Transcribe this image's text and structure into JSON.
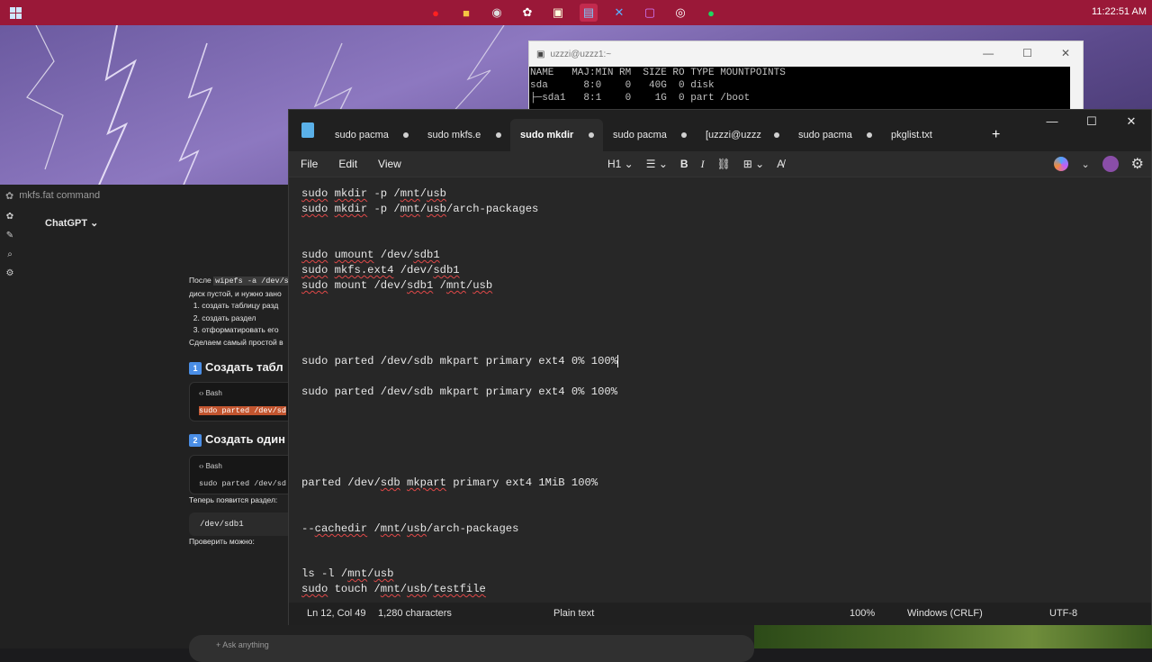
{
  "taskbar": {
    "clock": "11:22:51 AM",
    "icons": [
      "opera-icon",
      "files-icon",
      "obs-icon",
      "chatgpt-icon",
      "putty-icon",
      "notepad-icon",
      "vscode-icon",
      "onenote-icon",
      "github-icon",
      "spotify-icon"
    ]
  },
  "chatgpt": {
    "window_title": "mkfs.fat command",
    "model": "ChatGPT",
    "intro_prefix": "После",
    "intro_code": "wipefs -a /dev/sdb",
    "intro_line2": "диск пустой, и нужно зано",
    "steps": [
      "создать таблицу разд",
      "создать раздел",
      "отформатировать его"
    ],
    "simple_text": "Сделаем самый простой в",
    "h1": "Создать табл",
    "h1_num": "1",
    "block1_lang": "Bash",
    "block1_code": "sudo parted /dev/sd",
    "h2": "Создать один",
    "h2_num": "2",
    "block2_lang": "Bash",
    "block2_code": "sudo parted /dev/sd",
    "after_text": "Теперь появится раздел:",
    "mini_code": "/dev/sdb1",
    "check_text": "Проверить можно:",
    "ask_placeholder": "Ask anything"
  },
  "terminal": {
    "title": "uzzzi@uzzz1:~",
    "lines": [
      "NAME   MAJ:MIN RM  SIZE RO TYPE MOUNTPOINTS",
      "sda      8:0    0   40G  0 disk",
      "├─sda1   8:1    0    1G  0 part /boot"
    ]
  },
  "notepad": {
    "tabs": [
      {
        "label": "sudo pacma",
        "active": false
      },
      {
        "label": "sudo mkfs.e",
        "active": false
      },
      {
        "label": "sudo mkdir",
        "active": true
      },
      {
        "label": "sudo pacma",
        "active": false
      },
      {
        "label": "[uzzzi@uzzz",
        "active": false
      },
      {
        "label": "sudo pacma",
        "active": false
      },
      {
        "label": "pkglist.txt",
        "active": false
      }
    ],
    "new_tab": "+",
    "menu": {
      "file": "File",
      "edit": "Edit",
      "view": "View"
    },
    "toolbar": {
      "heading": "H1"
    },
    "lines": [
      "sudo mkdir -p /mnt/usb",
      "sudo mkdir -p /mnt/usb/arch-packages",
      "sudo umount /dev/sdb1",
      "sudo mkfs.ext4 /dev/sdb1",
      "sudo mount /dev/sdb1 /mnt/usb",
      "sudo parted /dev/sdb mkpart primary ext4 0% 100%",
      "sudo parted /dev/sdb mkpart primary ext4 0% 100%",
      "parted /dev/sdb mkpart primary ext4 1MiB 100%",
      "--cachedir /mnt/usb/arch-packages",
      "ls -l /mnt/usb",
      "sudo touch /mnt/usb/testfile"
    ],
    "status": {
      "position": "Ln 12, Col 49",
      "chars": "1,280 characters",
      "format": "Plain text",
      "zoom": "100%",
      "eol": "Windows (CRLF)",
      "encoding": "UTF-8"
    }
  }
}
